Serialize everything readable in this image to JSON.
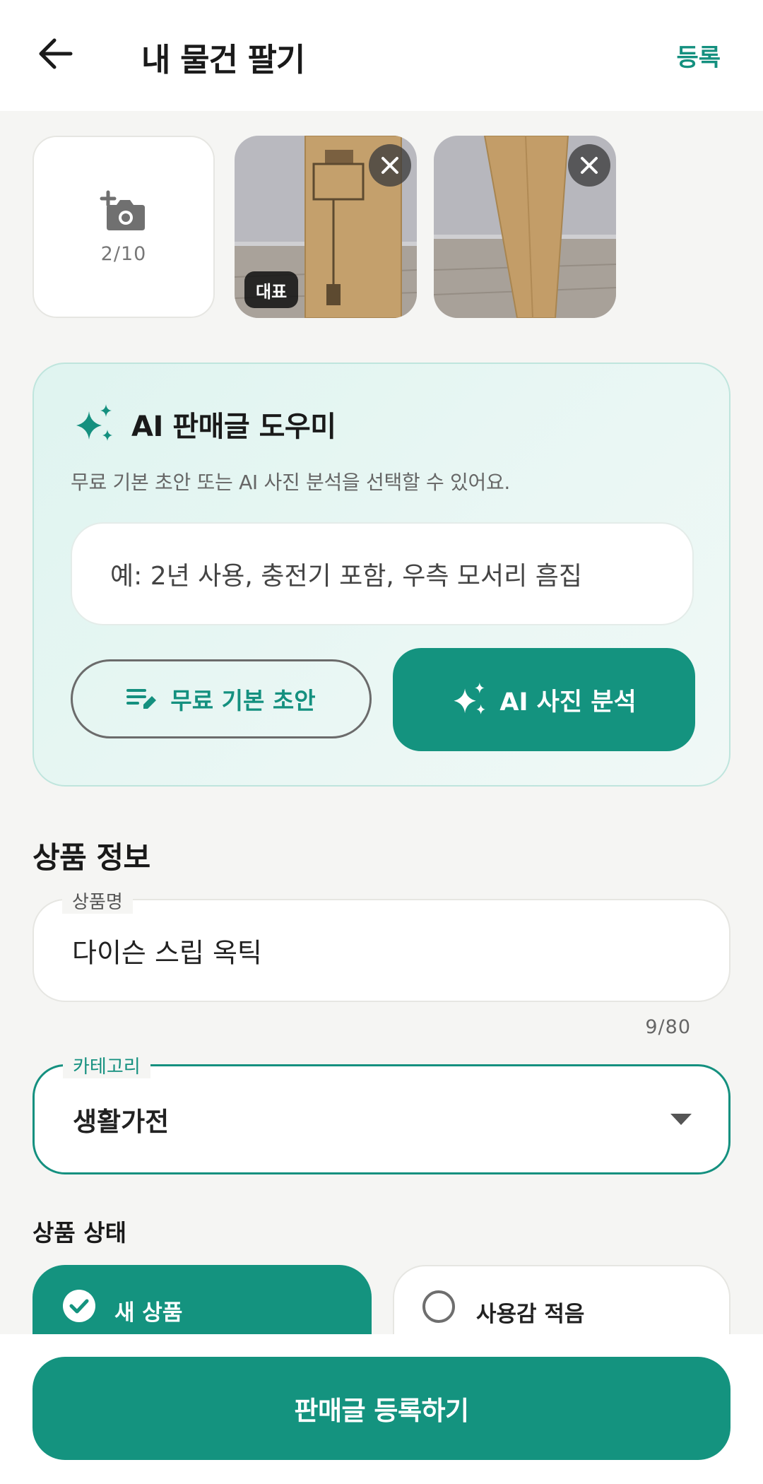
{
  "header": {
    "title": "내 물건 팔기",
    "register_label": "등록"
  },
  "photos": {
    "count": "2/10",
    "main_badge": "대표"
  },
  "ai_helper": {
    "title": "AI 판매글 도우미",
    "description": "무료 기본 초안 또는 AI 사진 분석을 선택할 수 있어요.",
    "input_placeholder": "예: 2년 사용, 충전기 포함, 우측 모서리 흠집",
    "free_draft_label": "무료 기본 초안",
    "photo_analysis_label": "AI 사진 분석"
  },
  "product_info": {
    "section_title": "상품 정보",
    "name_label": "상품명",
    "name_value": "다이슨 스립 옥틱",
    "name_count": "9/80",
    "category_label": "카테고리",
    "category_value": "생활가전",
    "condition_title": "상품 상태",
    "condition_options": [
      {
        "label": "새 상품",
        "selected": true
      },
      {
        "label": "사용감 적음",
        "selected": false
      }
    ]
  },
  "footer": {
    "submit_label": "판매글 등록하기"
  },
  "colors": {
    "accent": "#14937f",
    "background": "#f5f5f3"
  }
}
